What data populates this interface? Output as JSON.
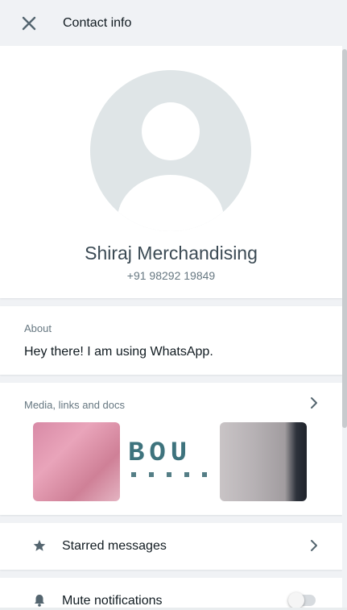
{
  "header": {
    "title": "Contact info",
    "close_icon": "close-icon"
  },
  "profile": {
    "name": "Shiraj Merchandising",
    "phone": "+91 98292 19849",
    "avatar_icon": "default-avatar-icon"
  },
  "about": {
    "label": "About",
    "text": "Hey there! I am using WhatsApp."
  },
  "media": {
    "label": "Media, links and docs",
    "chevron_icon": "chevron-right-icon",
    "thumbnails": [
      {
        "desc": "pink-image"
      },
      {
        "desc": "logo-image",
        "text": "BOU"
      },
      {
        "desc": "gray-image"
      }
    ]
  },
  "starred": {
    "label": "Starred messages",
    "icon": "star-icon",
    "chevron_icon": "chevron-right-icon"
  },
  "mute": {
    "label": "Mute notifications",
    "icon": "bell-icon",
    "toggle_on": false
  },
  "colors": {
    "panel": "#ffffff",
    "background": "#f0f2f5",
    "icon_gray": "#54656f",
    "secondary_text": "#667781"
  }
}
